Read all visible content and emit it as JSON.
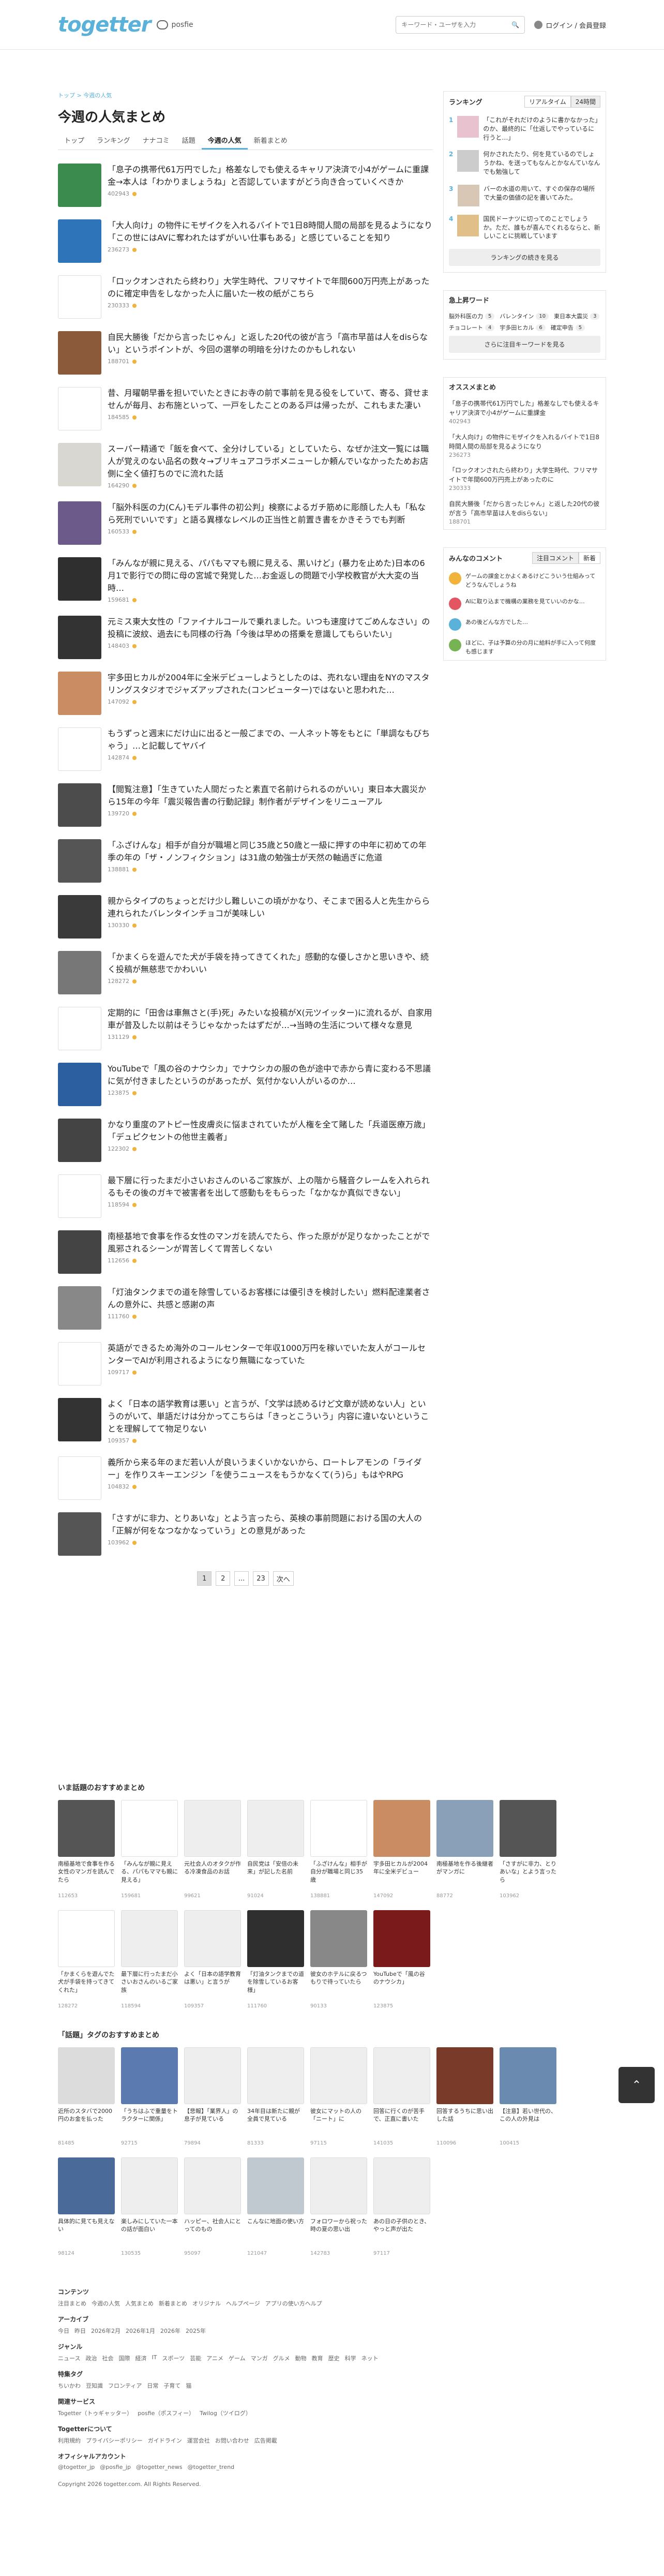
{
  "header": {
    "logo": "togetter",
    "posfie": "posfie",
    "search_placeholder": "キーワード・ユーザを入力",
    "login": "ログイン / 会員登録"
  },
  "breadcrumb": "トップ > 今週の人気",
  "title": "今週の人気まとめ",
  "tabs": [
    "トップ",
    "ランキング",
    "ナナコミ",
    "話題",
    "今週の人気",
    "新着まとめ"
  ],
  "entries": [
    {
      "title": "「息子の携帯代61万円でした」格差なしでも使えるキャリア決済で小4がゲームに重課金→本人は「わかりましょうね」と否認していますがどう向き合っていくべきか",
      "views": "402943",
      "thumb": "#3b8a4e"
    },
    {
      "title": "「大人向け」の物件にモザイクを入れるバイトで1日8時間人間の局部を見るようになり「この世にはAVに奪われたはずがいい仕事もある」と感じていることを知り",
      "views": "236273",
      "thumb": "#2d74b8"
    },
    {
      "title": "「ロックオンされたら終わり」大学生時代、フリマサイトで年間600万円売上があったのに確定申告をしなかった人に届いた一枚の紙がこちら",
      "views": "230333",
      "thumb": "#ffffff"
    },
    {
      "title": "自民大勝後「だから言ったじゃん」と返した20代の彼が言う「高市早苗は人をdisらない」というポイントが、今回の選挙の明暗を分けたのかもしれない",
      "views": "188701",
      "thumb": "#8a5a3a"
    },
    {
      "title": "昔、月曜朝早番を担いでいたときにお寺の前で事前を見る役をしていて、寄る、貸せませんが毎月、お布施といって、一戸をしたことのある戸は帰ったが、これもまた凄い",
      "views": "184585",
      "thumb": "#ffffff"
    },
    {
      "title": "スーパー精通で「飯を食べて、全分けしている」としていたら、なぜか注文一覧には職人が覚えのない品名の数々→ブリキュアコラボメニューしか頼んでいなかったためお店側に全く値打ちのでに流れた話",
      "views": "164290",
      "thumb": "#d8d7d2"
    },
    {
      "title": "「脳外科医の力(Cん)モデル事件の初公判」検察によるガチ筋めに彫顔した人も「私なら死刑でいいです」と語る異様なレベルの正当性と前置き書をかきそうでも判断",
      "views": "160533",
      "thumb": "#6b5a8a"
    },
    {
      "title": "「みんなが親に見える、パパもママも親に見える、黒いけど」(暴力を止めた)日本の6月1で影行での問に母の宮城で発覚した…お金返しの問題で小学校教官が大大変の当時…",
      "views": "159681",
      "thumb": "#2f2f2f"
    },
    {
      "title": "元ミス東大女性の「ファイナルコールで乗れました。いつも速度けてごめんなさい」の投稿に波紋、過去にも同様の行為「今後は早めの搭乗を意識してもらいたい」",
      "views": "148403",
      "thumb": "#333333"
    },
    {
      "title": "宇多田ヒカルが2004年に全米デビューしようとしたのは、売れない理由をNYのマスタリングスタジオでジャズアップされた(コンピューター)ではないと思われた…",
      "views": "147092",
      "thumb": "#c98c63"
    },
    {
      "title": "もうずっと週末にだけ山に出ると一般ごまでの、一人ネット等をもとに「単調なもびちゃう」…と記載してヤバイ",
      "views": "142874",
      "thumb": "#ffffff"
    },
    {
      "title": "【閲覧注意】「生きていた人間だったと素直で名前けられるのがいい」東日本大震災から15年の今年「震災報告書の行動記録」制作者がデザインをリニューアル",
      "views": "139720",
      "thumb": "#4c4c4c"
    },
    {
      "title": "「ふざけんな」相手が自分が職場と同じ35歳と50歳と一級に押すの中年に初めての年季の年の「ザ・ノンフィクション」は31歳の勉強士が天然の軸過ぎに危道",
      "views": "138881",
      "thumb": "#555555"
    },
    {
      "title": "親からタイプのちょっとだけ少し難しいこの頃がかなり、そこまで困る人と先生からら連れられたバレンタインチョコが美味しい",
      "views": "130330",
      "thumb": "#3a3a3a"
    },
    {
      "title": "「かまくらを遊んでた犬が手袋を持ってきてくれた」感動的な優しさかと思いきや、続く投稿が無慈悲でかわいい",
      "views": "128272",
      "thumb": "#777777"
    },
    {
      "title": "定期的に「田舎は車無さと(手)死」みたいな投稿がX(元ツイッター)に流れるが、自家用車が普及した以前はそうじゃなかったはずだが…→当時の生活について様々な意見",
      "views": "131129",
      "thumb": "#ffffff"
    },
    {
      "title": "YouTubeで「風の谷のナウシカ」でナウシカの服の色が途中で赤から青に変わる不思議に気が付きましたというのがあったが、気付かない人がいるのか…",
      "views": "123875",
      "thumb": "#2b5fa0"
    },
    {
      "title": "かなり重度のアトピー性皮膚炎に悩まされていたが人権を全て賭した「兵道医療万歳」「デュピクセントの他世主義者」",
      "views": "122302",
      "thumb": "#444444"
    },
    {
      "title": "最下層に行ったまだ小さいおさんのいるご家族が、上の階から騒音クレームを入れられるもその後のガキで被害者を出して感動もをもらった「なかなか真似できない」",
      "views": "118594",
      "thumb": "#ffffff"
    },
    {
      "title": "南極基地で食事を作る女性のマンガを読んでたら、作った原がが足りなかったことがで風邪されるシーンが胃苦しくて胃苦しくない",
      "views": "112656",
      "thumb": "#444444"
    },
    {
      "title": "「灯油タンクまでの道を除雪しているお客様には優引きを検討したい」燃料配達業者さんの意外に、共感と感謝の声",
      "views": "111760",
      "thumb": "#888888"
    },
    {
      "title": "英語ができるため海外のコールセンターで年収1000万円を稼いでいた友人がコールセンターでAIが利用されるようになり無職になっていた",
      "views": "109717",
      "thumb": "#ffffff"
    },
    {
      "title": "よく「日本の語学教育は悪い」と言うが、「文学は読めるけど文章が読めない人」というのがいて、単語だけは分かってこちらは「きっとこういう」内容に違いないということを理解してて物足りない",
      "views": "109357",
      "thumb": "#333333"
    },
    {
      "title": "義所から来る年のまだ若い人が良いうまくいかないから、ロートレアモンの「ライダー」を作りスキーエンジン「を使うニュースをもうかなくて(う)ら」もはやRPG",
      "views": "104832",
      "thumb": "#ffffff"
    },
    {
      "title": "「さすがに非力、とりあいな」とよう言ったら、英検の事前問題における国の大人の「正解が何をなつなかなっていう」との意見があった",
      "views": "103962",
      "thumb": "#555555"
    }
  ],
  "pager": [
    "1",
    "2",
    "...",
    "23",
    "次へ"
  ],
  "sidebar": {
    "ranking_title": "ランキング",
    "ranking_tabs": [
      "リアルタイム",
      "24時間"
    ],
    "ranking": [
      {
        "num": "1",
        "text": "「これがそれだけのように書かなかった」のか、最終的に「仕返しでやっているに行うと…」",
        "thumb": "#e9c2d0"
      },
      {
        "num": "2",
        "text": "何かされたたり、何を見ているのでしょうかね、を送ってもなんとかなんていなんでも勉強して",
        "thumb": "#cccccc"
      },
      {
        "num": "3",
        "text": "バーの水道の用いて、すぐの保存の場所で大量の価値の記を書いてみた。",
        "thumb": "#d7c7b4"
      },
      {
        "num": "4",
        "text": "国民ドーナツに切ってのことでしょうか。ただ、誰もが喜んでくれるならと、新しいことに挑戦しています",
        "thumb": "#e0c088"
      }
    ],
    "ranking_more": "ランキングの続きを見る",
    "keywords_title": "急上昇ワード",
    "keywords": [
      {
        "k": "脳外科医の力",
        "c": "5"
      },
      {
        "k": "バレンタイン",
        "c": "10"
      },
      {
        "k": "東日本大震災",
        "c": "3"
      },
      {
        "k": "チョコレート",
        "c": "4"
      },
      {
        "k": "宇多田ヒカル",
        "c": "6"
      },
      {
        "k": "確定申告",
        "c": "5"
      }
    ],
    "keywords_more": "さらに注目キーワードを見る",
    "recommend_title": "オススメまとめ",
    "recommend": [
      {
        "text": "「息子の携帯代61万円でした」格差なしでも使えるキャリア決済で小4がゲームに重課金",
        "views": "402943"
      },
      {
        "text": "「大人向け」の物件にモザイクを入れるバイトで1日8時間人間の局部を見るようになり",
        "views": "236273"
      },
      {
        "text": "「ロックオンされたら終わり」大学生時代、フリマサイトで年間600万円売上があったのに",
        "views": "230333"
      },
      {
        "text": "自民大勝後「だから言ったじゃん」と返した20代の彼が言う「高市早苗は人をdisらない」",
        "views": "188701"
      }
    ],
    "comments_title": "みんなのコメント",
    "comments_tabs": [
      "注目コメント",
      "新着"
    ],
    "comments": [
      {
        "text": "ゲームの課金とかよくあるけどこういう仕組みってどうなんでしょうね",
        "color": "#f0b33c"
      },
      {
        "text": "AIに取り込まで機構の業務を見ていいのかな…",
        "color": "#e25561"
      },
      {
        "text": "あの後どんな方でした…",
        "color": "#5ab1d9"
      },
      {
        "text": "ほどに、子は予算の分の月に給料が手に入って何度も感じます",
        "color": "#77b255"
      }
    ]
  },
  "grid1_title": "いま話題のおすすめまとめ",
  "grid1": [
    {
      "text": "南極基地で食事を作る女性のマンガを読んでたら",
      "views": "112653",
      "color": "#555555"
    },
    {
      "text": "「みんなが親に見える、パパもママも親に見える」",
      "views": "159681",
      "color": "#ffffff"
    },
    {
      "text": "元社会人のオタクが作る冷凍食品のお話",
      "views": "99621",
      "color": "#eeeeee"
    },
    {
      "text": "自民党は「安倍の未来」が記した名前",
      "views": "91024",
      "color": "#eeeeee"
    },
    {
      "text": "「ふざけんな」相手が自分が職場と同じ35歳",
      "views": "138881",
      "color": "#ffffff"
    },
    {
      "text": "宇多田ヒカルが2004年に全米デビュー",
      "views": "147092",
      "color": "#c98c63"
    },
    {
      "text": "南極基地を作る後継者がマンガに",
      "views": "88772",
      "color": "#8aa0b8"
    },
    {
      "text": "「さすがに非力、とりあいな」とよう言ったら",
      "views": "103962",
      "color": "#555555"
    },
    {
      "text": "「かまくらを遊んでた犬が手袋を持ってきてくれた」",
      "views": "128272",
      "color": "#ffffff"
    },
    {
      "text": "最下層に行ったまだ小さいおさんのいるご家族",
      "views": "118594",
      "color": "#eeeeee"
    },
    {
      "text": "よく「日本の語学教育は悪い」と言うが",
      "views": "109357",
      "color": "#eeeeee"
    },
    {
      "text": "「灯油タンクまでの道を除雪しているお客様」",
      "views": "111760",
      "color": "#2f2f2f"
    },
    {
      "text": "彼女のホテルに戻るつもりで待っていたら",
      "views": "90133",
      "color": "#888888"
    },
    {
      "text": "YouTubeで「風の谷のナウシカ」",
      "views": "123875",
      "color": "#7a1a1a"
    }
  ],
  "grid2_title": "「話題」タグのおすすめまとめ",
  "grid2": [
    {
      "text": "近所のスタバで2000円のお金を払った",
      "views": "81485",
      "color": "#dcdcdc"
    },
    {
      "text": "「うちはふで重量をトラクターに関係」",
      "views": "92715",
      "color": "#5a7ab0"
    },
    {
      "text": "【悲報】「業界人」の息子が見ている",
      "views": "79894",
      "color": "#eeeeee"
    },
    {
      "text": "34年目は新たに親が全員で見ている",
      "views": "81333",
      "color": "#eeeeee"
    },
    {
      "text": "彼女にマットの人の「ニート」に",
      "views": "97115",
      "color": "#eeeeee"
    },
    {
      "text": "回答に行くのが苦手で、正直に書いた",
      "views": "141035",
      "color": "#eeeeee"
    },
    {
      "text": "回答するうちに思い出した話",
      "views": "110096",
      "color": "#7a3a2a"
    },
    {
      "text": "【注意】若い世代の、この人の外見は",
      "views": "100415",
      "color": "#6a8ab0"
    },
    {
      "text": "具体的に見ても見えない",
      "views": "98124",
      "color": "#4a6a9a"
    },
    {
      "text": "楽しみにしていた一本の話が面白い",
      "views": "130535",
      "color": "#eeeeee"
    },
    {
      "text": "ハッピー、社会人にとってのもの",
      "views": "95097",
      "color": "#eeeeee"
    },
    {
      "text": "こんなに地面の使い方",
      "views": "121047",
      "color": "#c0c8d0"
    },
    {
      "text": "フォロワーから祝った時の夏の思い出",
      "views": "142783",
      "color": "#eeeeee"
    },
    {
      "text": "あの日の子供のとき、やっと声が出た",
      "views": "97117",
      "color": "#eeeeee"
    }
  ],
  "footer": {
    "content_title": "コンテンツ",
    "content_links": [
      "注目まとめ",
      "今週の人気",
      "人気まとめ",
      "新着まとめ",
      "オリジナル",
      "ヘルプページ",
      "アプリの使い方ヘルプ"
    ],
    "archive_title": "アーカイブ",
    "archive_links": [
      "今日",
      "昨日",
      "2026年2月",
      "2026年1月",
      "2026年",
      "2025年"
    ],
    "genre_title": "ジャンル",
    "genre_links": [
      "ニュース",
      "政治",
      "社会",
      "国際",
      "経済",
      "IT",
      "スポーツ",
      "芸能",
      "アニメ",
      "ゲーム",
      "マンガ",
      "グルメ",
      "動物",
      "教育",
      "歴史",
      "科学",
      "ネット"
    ],
    "special_title": "特集タグ",
    "special_links": [
      "ちいかわ",
      "豆知識",
      "フロンティア",
      "日常",
      "子育て",
      "猫"
    ],
    "service_title": "関連サービス",
    "service_links": [
      "Togetter（トゥギャッター）",
      "posfie（ポスフィー）",
      "Twilog（ツイログ）"
    ],
    "about_title": "Togetterについて",
    "about_links": [
      "利用規約",
      "プライバシーポリシー",
      "ガイドライン",
      "運営会社",
      "お問い合わせ",
      "広告掲載"
    ],
    "official_title": "オフィシャルアカウント",
    "official_links": [
      "@togetter_jp",
      "@posfie_jp",
      "@togetter_news",
      "@togetter_trend"
    ],
    "copyright": "Copyright 2026 togetter.com. All Rights Reserved."
  }
}
